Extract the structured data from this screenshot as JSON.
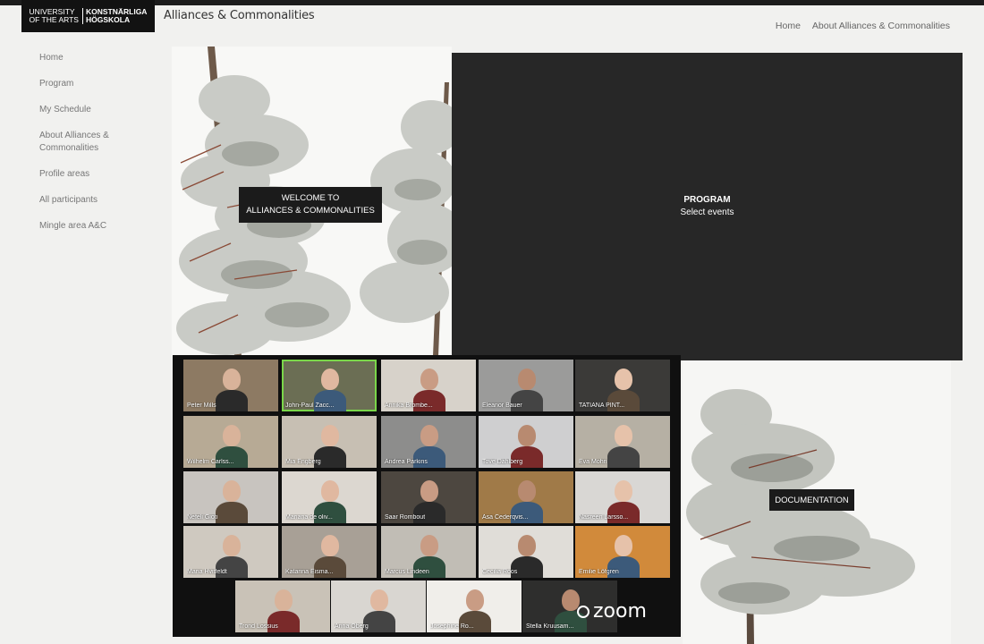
{
  "logo": {
    "left_lines": [
      "UNIVERSITY",
      "OF THE ARTS"
    ],
    "right_lines": [
      "KONSTNÄRLIGA",
      "HÖGSKOLA"
    ]
  },
  "site_title": "Alliances & Commonalities",
  "top_nav": [
    "Home",
    "About Alliances & Commonalities"
  ],
  "sidebar": {
    "items": [
      {
        "label": "Home"
      },
      {
        "label": "Program"
      },
      {
        "label": "My Schedule"
      },
      {
        "label": "About Alliances &\nCommonalities"
      },
      {
        "label": "Profile areas"
      },
      {
        "label": "All participants"
      },
      {
        "label": "Mingle area A&C"
      }
    ]
  },
  "welcome": {
    "line1": "WELCOME TO",
    "line2": "ALLIANCES & COMMONALITIES"
  },
  "program": {
    "title": "PROGRAM",
    "subtitle": "Select events"
  },
  "documentation": {
    "label": "DOCUMENTATION"
  },
  "zoom": {
    "brand": "zoom",
    "participants": [
      {
        "name": "Peter Mills"
      },
      {
        "name": "John-Paul Zacc..."
      },
      {
        "name": "Annika Brombe..."
      },
      {
        "name": "Eleanor Bauer"
      },
      {
        "name": "TATIANA PINT..."
      },
      {
        "name": "Wilhelm Carlss..."
      },
      {
        "name": "Mia Engberg"
      },
      {
        "name": "Andrea Parkins"
      },
      {
        "name": "Tove Dahlberg"
      },
      {
        "name": "Eva Mohn"
      },
      {
        "name": "Nefeli Gioti"
      },
      {
        "name": "Mariana de oliv..."
      },
      {
        "name": "Saar Rombout"
      },
      {
        "name": "Åsa Cederqvis..."
      },
      {
        "name": "Nasreen Larsso..."
      },
      {
        "name": "Maria Hvitfeldt"
      },
      {
        "name": "Katarina Eisma..."
      },
      {
        "name": "Marcus Lindeen"
      },
      {
        "name": "Cecilia Roos"
      },
      {
        "name": "Emilie Löfgren"
      },
      {
        "name": "Trond Lossius"
      },
      {
        "name": "Anna Öberg"
      },
      {
        "name": "Josephine Ro..."
      },
      {
        "name": "Stella Kruusam..."
      }
    ]
  }
}
